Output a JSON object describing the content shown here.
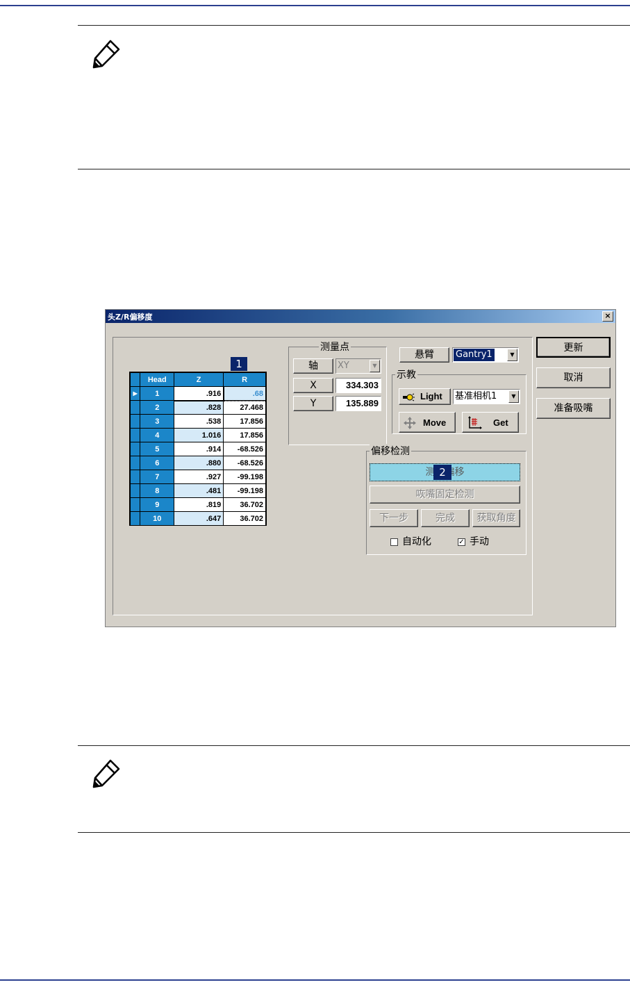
{
  "dialog": {
    "title": "头Z/R偏移度",
    "close_glyph": "×",
    "table": {
      "headers": [
        "Head",
        "Z",
        "R"
      ],
      "rows": [
        {
          "head": "1",
          "z": ".916",
          "r": ".68"
        },
        {
          "head": "2",
          "z": ".828",
          "r": "27.468"
        },
        {
          "head": "3",
          "z": ".538",
          "r": "17.856"
        },
        {
          "head": "4",
          "z": "1.016",
          "r": "17.856"
        },
        {
          "head": "5",
          "z": ".914",
          "r": "-68.526"
        },
        {
          "head": "6",
          "z": ".880",
          "r": "-68.526"
        },
        {
          "head": "7",
          "z": ".927",
          "r": "-99.198"
        },
        {
          "head": "8",
          "z": ".481",
          "r": "-99.198"
        },
        {
          "head": "9",
          "z": ".819",
          "r": "36.702"
        },
        {
          "head": "10",
          "z": ".647",
          "r": "36.702"
        }
      ],
      "row_indicator": "▶"
    },
    "measure": {
      "group_label": "测量点",
      "axis_label": "轴",
      "axis_value": "XY",
      "x_label": "X",
      "x_value": "334.303",
      "y_label": "Y",
      "y_value": "135.889"
    },
    "arm": {
      "label": "悬臂",
      "value": "Gantry1"
    },
    "teach": {
      "group_label": "示教",
      "light_label": "Light",
      "camera_value": "基准相机1",
      "move_label": "Move",
      "get_label": "Get"
    },
    "offset": {
      "group_label": "偏移检测",
      "measure_btn": "测试偏移",
      "nozzle_btn": "咴嘴固定检测",
      "next_btn": "下一步",
      "done_btn": "完成",
      "angle_btn": "获取角度",
      "auto_label": "自动化",
      "auto_checked": false,
      "manual_label": "手动",
      "manual_checked": true
    },
    "side_buttons": {
      "update": "更新",
      "cancel": "取消",
      "prepare": "准备吸嘴"
    },
    "badges": {
      "one": "1",
      "two": "2"
    },
    "arrow_glyph": "▼",
    "check_glyph": "✓"
  }
}
